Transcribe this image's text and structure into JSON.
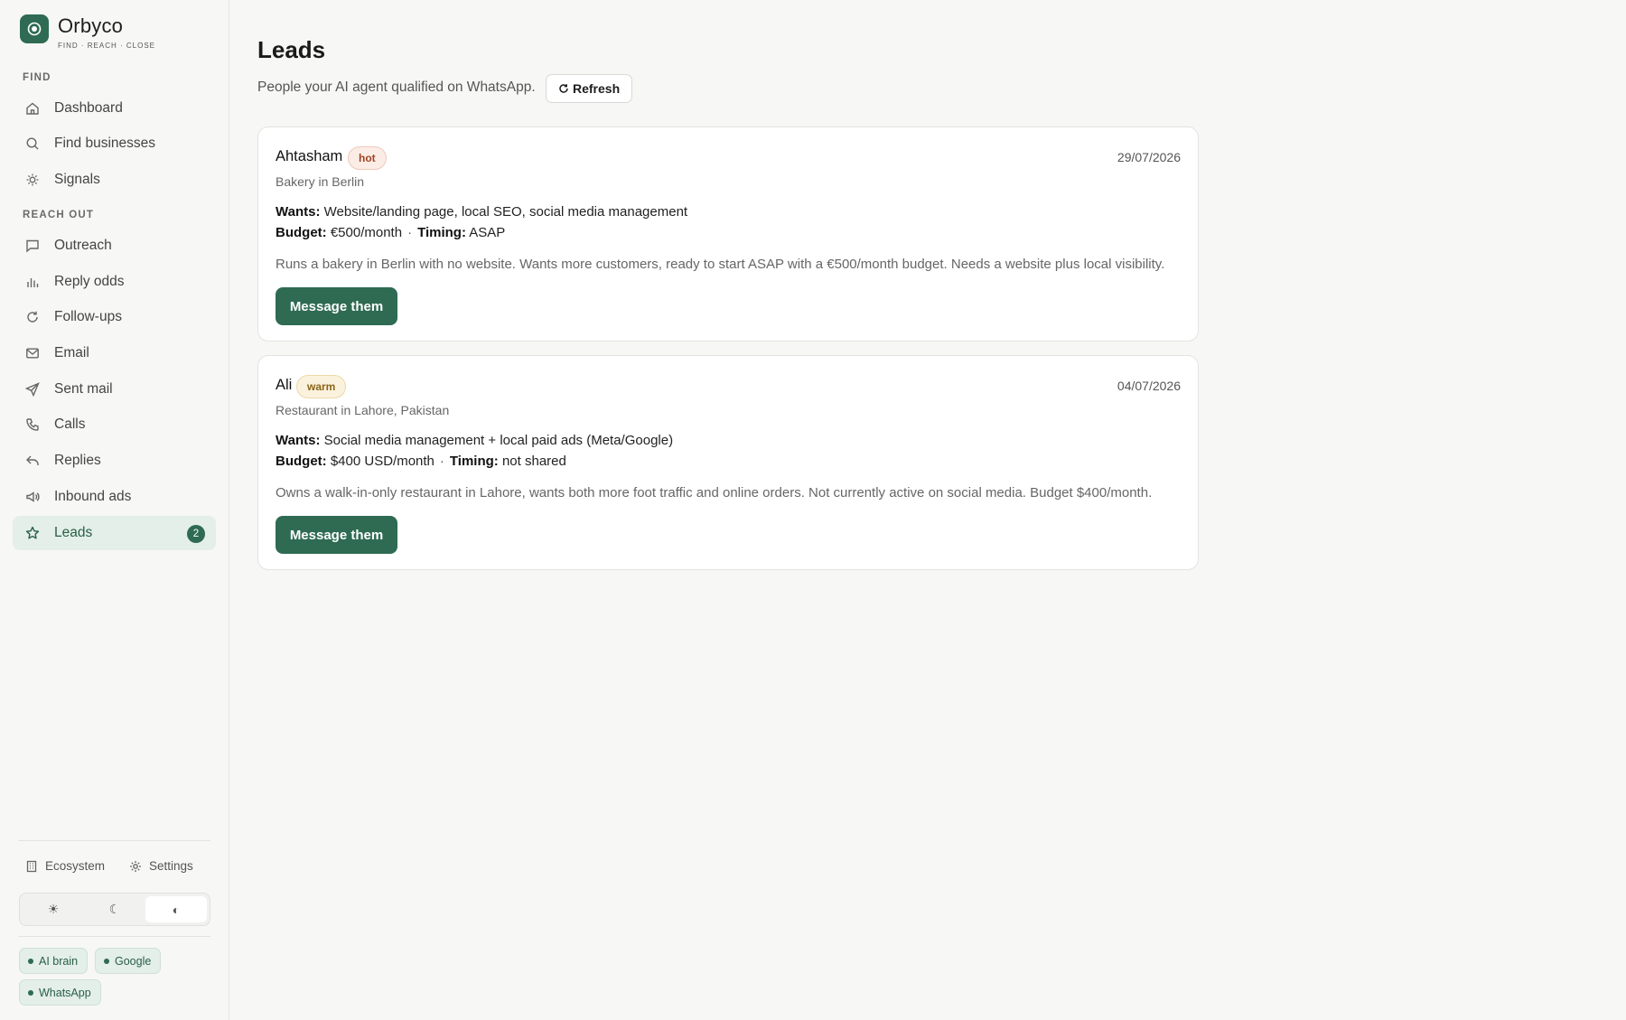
{
  "brand": {
    "name": "Orbyco",
    "tagline": "FIND · REACH · CLOSE"
  },
  "sidebar": {
    "sections": [
      {
        "label": "FIND"
      },
      {
        "label": "REACH OUT"
      }
    ],
    "items": [
      {
        "label": "Dashboard",
        "icon": "home-icon"
      },
      {
        "label": "Find businesses",
        "icon": "search-icon"
      },
      {
        "label": "Signals",
        "icon": "sun-icon"
      },
      {
        "label": "Outreach",
        "icon": "chat-icon"
      },
      {
        "label": "Reply odds",
        "icon": "bar-chart-icon"
      },
      {
        "label": "Follow-ups",
        "icon": "refresh-icon"
      },
      {
        "label": "Email",
        "icon": "mail-icon"
      },
      {
        "label": "Sent mail",
        "icon": "send-icon"
      },
      {
        "label": "Calls",
        "icon": "phone-icon"
      },
      {
        "label": "Replies",
        "icon": "reply-icon"
      },
      {
        "label": "Inbound ads",
        "icon": "megaphone-icon"
      },
      {
        "label": "Leads",
        "icon": "star-icon",
        "badge": "2",
        "active": true
      }
    ],
    "footer": {
      "ecosystem": "Ecosystem",
      "settings": "Settings",
      "theme": {
        "light": "☀",
        "dark": "☾",
        "system": "◐",
        "selected": "system"
      },
      "chips": [
        "AI brain",
        "Google",
        "WhatsApp"
      ]
    }
  },
  "main": {
    "title": "Leads",
    "subtitle": "People your AI agent qualified on WhatsApp.",
    "refresh_label": "Refresh",
    "leads": [
      {
        "name": "Ahtasham",
        "temperature": "hot",
        "date": "29/07/2026",
        "location": "Bakery in Berlin",
        "wants_label": "Wants:",
        "wants": "Website/landing page, local SEO, social media management",
        "budget_label": "Budget:",
        "budget": "€500/month",
        "timing_label": "Timing:",
        "timing": "ASAP",
        "summary": "Runs a bakery in Berlin with no website. Wants more customers, ready to start ASAP with a €500/month budget. Needs a website plus local visibility.",
        "action": "Message them"
      },
      {
        "name": "Ali",
        "temperature": "warm",
        "date": "04/07/2026",
        "location": "Restaurant in Lahore, Pakistan",
        "wants_label": "Wants:",
        "wants": "Social media management + local paid ads (Meta/Google)",
        "budget_label": "Budget:",
        "budget": "$400 USD/month",
        "timing_label": "Timing:",
        "timing": "not shared",
        "summary": "Owns a walk-in-only restaurant in Lahore, wants both more foot traffic and online orders. Not currently active on social media. Budget $400/month.",
        "action": "Message them"
      }
    ]
  },
  "colors": {
    "accent": "#2e6b52",
    "accent_soft": "#e3efe8",
    "hot": "#a04428",
    "warm": "#8a6418",
    "background": "#f7f7f6"
  }
}
